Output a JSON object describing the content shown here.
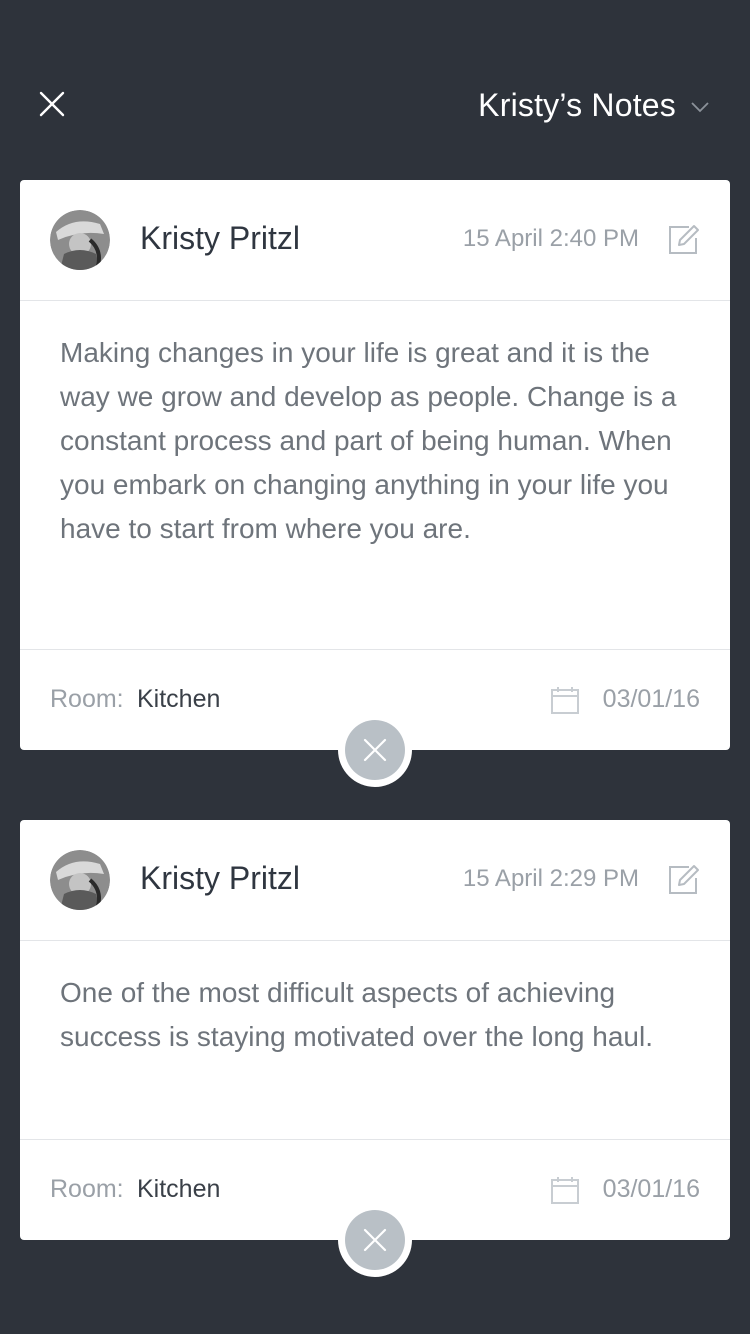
{
  "header": {
    "title": "Kristy’s Notes",
    "close_icon": "close-icon",
    "dropdown_icon": "chevron-down-icon"
  },
  "notes": [
    {
      "author": "Kristy Pritzl",
      "timestamp": "15 April 2:40 PM",
      "body": "Making changes in your life is great and it is the way we grow and develop as people. Change is a constant process and part of being human. When you embark on changing anything in your life you have to start from where you are.",
      "room_label": "Room:",
      "room": "Kitchen",
      "date": "03/01/16"
    },
    {
      "author": "Kristy Pritzl",
      "timestamp": "15 April 2:29 PM",
      "body": "One of the most difficult aspects of achieving success is staying motivated over the long haul.",
      "room_label": "Room:",
      "room": "Kitchen",
      "date": "03/01/16"
    }
  ],
  "colors": {
    "background": "#2e333b",
    "card": "#ffffff",
    "delete_button": "#b9c0c6"
  }
}
